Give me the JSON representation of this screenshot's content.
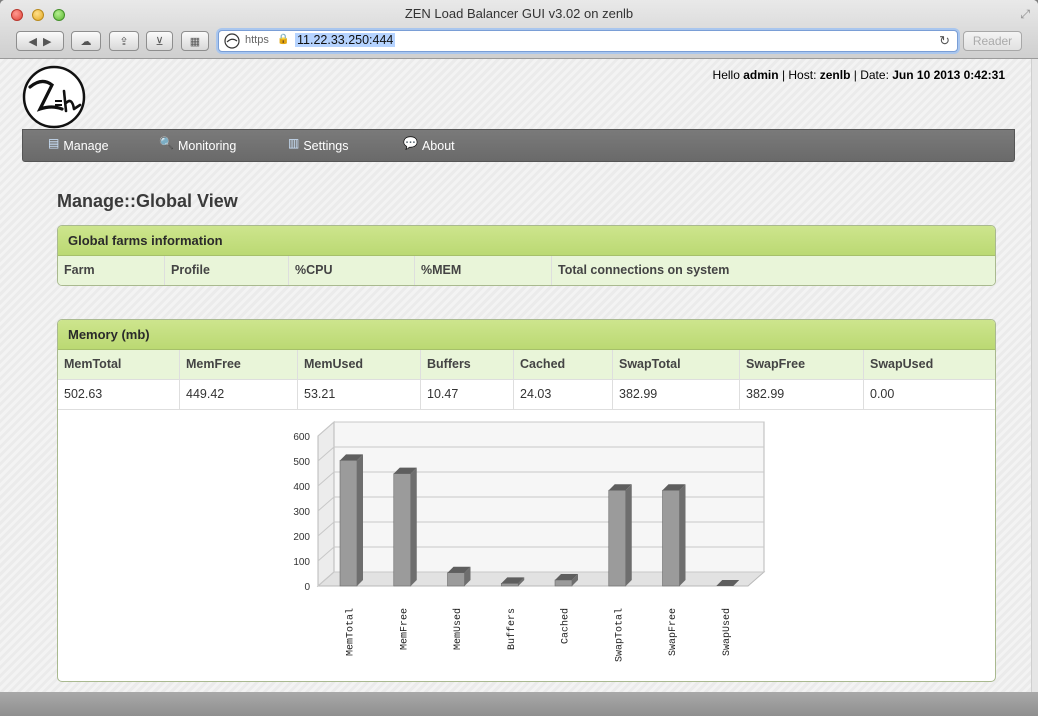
{
  "window": {
    "title": "ZEN Load Balancer GUI v3.02 on zenlb"
  },
  "toolbar": {
    "https_label": "https",
    "url": "11.22.33.250:444",
    "reader_label": "Reader"
  },
  "header": {
    "hello_prefix": "Hello",
    "user": "admin",
    "sep1": "| Host:",
    "host": "zenlb",
    "sep2": "| Date:",
    "date": "Jun 10 2013 0:42:31"
  },
  "menu": [
    {
      "label": "Manage"
    },
    {
      "label": "Monitoring"
    },
    {
      "label": "Settings"
    },
    {
      "label": "About"
    }
  ],
  "page": {
    "title": "Manage::Global View"
  },
  "farms_panel": {
    "title": "Global farms information",
    "columns": [
      "Farm",
      "Profile",
      "%CPU",
      "%MEM",
      "Total connections on system"
    ]
  },
  "memory_panel": {
    "title": "Memory (mb)",
    "columns": [
      "MemTotal",
      "MemFree",
      "MemUsed",
      "Buffers",
      "Cached",
      "SwapTotal",
      "SwapFree",
      "SwapUsed"
    ],
    "values": [
      "502.63",
      "449.42",
      "53.21",
      "10.47",
      "24.03",
      "382.99",
      "382.99",
      "0.00"
    ]
  },
  "chart_data": {
    "type": "bar",
    "categories": [
      "MemTotal",
      "MemFree",
      "MemUsed",
      "Buffers",
      "Cached",
      "SwapTotal",
      "SwapFree",
      "SwapUsed"
    ],
    "values": [
      502.63,
      449.42,
      53.21,
      10.47,
      24.03,
      382.99,
      382.99,
      0.0
    ],
    "yticks": [
      0,
      100,
      200,
      300,
      400,
      500,
      600
    ],
    "ylim": [
      0,
      600
    ],
    "grid": true,
    "style": "3d",
    "bar_color": "#9a9a9a"
  }
}
